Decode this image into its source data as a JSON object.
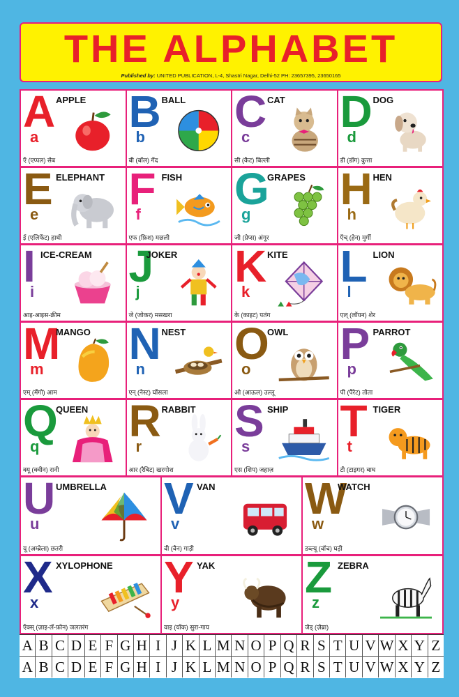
{
  "header": {
    "title": "THE ALPHABET",
    "published_by": "Published by:",
    "publisher_details": "UNITED PUBLICATION,  L-4, Shastri Nagar,  Delhi-52 PH: 23657395, 23650165"
  },
  "colors": {
    "background": "#4fb6e3",
    "header": "#fff200",
    "title": "#e8202a",
    "grid": "#e8207a"
  },
  "letters": [
    {
      "upper": "A",
      "lower": "a",
      "word": "APPLE",
      "hindi": "एँ (एप्पल) सेब",
      "color": "#e8202a",
      "icon": "apple-icon"
    },
    {
      "upper": "B",
      "lower": "b",
      "word": "BALL",
      "hindi": "बी (बॉल) गेंद",
      "color": "#1f62b4",
      "icon": "ball-icon"
    },
    {
      "upper": "C",
      "lower": "c",
      "word": "CAT",
      "hindi": "सी (कैट) बिल्ली",
      "color": "#7a3d9a",
      "icon": "cat-icon"
    },
    {
      "upper": "D",
      "lower": "d",
      "word": "DOG",
      "hindi": "डी (डॉग) कुत्ता",
      "color": "#1a9a3c",
      "icon": "dog-icon"
    },
    {
      "upper": "E",
      "lower": "e",
      "word": "ELEPHANT",
      "hindi": "ई (एलिफेंट) हाथी",
      "color": "#8a5a12",
      "icon": "elephant-icon"
    },
    {
      "upper": "F",
      "lower": "f",
      "word": "FISH",
      "hindi": "एफ (फ़िश) मछली",
      "color": "#e8207a",
      "icon": "fish-icon"
    },
    {
      "upper": "G",
      "lower": "g",
      "word": "GRAPES",
      "hindi": "जी (ग्रेप्स) अंगूर",
      "color": "#1aa39a",
      "icon": "grapes-icon"
    },
    {
      "upper": "H",
      "lower": "h",
      "word": "HEN",
      "hindi": "एँच् (हेन) मुर्गी",
      "color": "#9a6a14",
      "icon": "hen-icon"
    },
    {
      "upper": "I",
      "lower": "i",
      "word": "ICE-CREAM",
      "hindi": "आइ-आइस-क्रीम",
      "color": "#7a3d9a",
      "icon": "ice-cream-icon"
    },
    {
      "upper": "J",
      "lower": "j",
      "word": "JOKER",
      "hindi": "जे (जोकर) मसखरा",
      "color": "#1a9a3c",
      "icon": "joker-icon"
    },
    {
      "upper": "K",
      "lower": "k",
      "word": "KITE",
      "hindi": "के (काइट) पतंग",
      "color": "#e8202a",
      "icon": "kite-icon"
    },
    {
      "upper": "L",
      "lower": "l",
      "word": "LION",
      "hindi": "एल् (लॉयन) शेर",
      "color": "#1f62b4",
      "icon": "lion-icon"
    },
    {
      "upper": "M",
      "lower": "m",
      "word": "MANGO",
      "hindi": "एम् (मेंगो) आम",
      "color": "#e8202a",
      "icon": "mango-icon"
    },
    {
      "upper": "N",
      "lower": "n",
      "word": "NEST",
      "hindi": "एन् (नेस्ट) घोंसला",
      "color": "#1f62b4",
      "icon": "nest-icon"
    },
    {
      "upper": "O",
      "lower": "o",
      "word": "OWL",
      "hindi": "ओ (आऊल) उल्लू",
      "color": "#8a5a12",
      "icon": "owl-icon"
    },
    {
      "upper": "P",
      "lower": "p",
      "word": "PARROT",
      "hindi": "पी (पैरेट) तोता",
      "color": "#7a3d9a",
      "icon": "parrot-icon"
    },
    {
      "upper": "Q",
      "lower": "q",
      "word": "QUEEN",
      "hindi": "क्यू (क्वीन) रानी",
      "color": "#1a9a3c",
      "icon": "queen-icon"
    },
    {
      "upper": "R",
      "lower": "r",
      "word": "RABBIT",
      "hindi": "आर (रैबिट) खरगोश",
      "color": "#8a5a12",
      "icon": "rabbit-icon"
    },
    {
      "upper": "S",
      "lower": "s",
      "word": "SHIP",
      "hindi": "एस (शिप) जहाज़",
      "color": "#7a3d9a",
      "icon": "ship-icon"
    },
    {
      "upper": "T",
      "lower": "t",
      "word": "TIGER",
      "hindi": "टी (टाइगर) बाघ",
      "color": "#e8202a",
      "icon": "tiger-icon"
    },
    {
      "upper": "U",
      "lower": "u",
      "word": "UMBRELLA",
      "hindi": "यू (अम्ब्रेला) छतरी",
      "color": "#7a3d9a",
      "icon": "umbrella-icon"
    },
    {
      "upper": "V",
      "lower": "v",
      "word": "VAN",
      "hindi": "वी (वैन) गाड़ी",
      "color": "#1f62b4",
      "icon": "van-icon"
    },
    {
      "upper": "W",
      "lower": "w",
      "word": "WATCH",
      "hindi": "डब्ल्यू (वॉच) घड़ी",
      "color": "#8a5a12",
      "icon": "watch-icon"
    },
    {
      "upper": "X",
      "lower": "x",
      "word": "XYLOPHONE",
      "hindi": "एँक्स् (ज़ाइ-लॅ-फ़ोन) जलतरंग",
      "color": "#1f2a8a",
      "icon": "xylophone-icon"
    },
    {
      "upper": "Y",
      "lower": "y",
      "word": "YAK",
      "hindi": "वाइ (यॉक) सुरा-गाय",
      "color": "#e8202a",
      "icon": "yak-icon"
    },
    {
      "upper": "Z",
      "lower": "z",
      "word": "ZEBRA",
      "hindi": "जेड् (ज़ेब्रा)",
      "color": "#1a9a3c",
      "icon": "zebra-icon"
    }
  ],
  "strip": {
    "row1": [
      "A",
      "B",
      "C",
      "D",
      "E",
      "F",
      "G",
      "H",
      "I",
      "J",
      "K",
      "L",
      "M",
      "N",
      "O",
      "P",
      "Q",
      "R",
      "S",
      "T",
      "U",
      "V",
      "W",
      "X",
      "Y",
      "Z"
    ],
    "row2": [
      "A",
      "B",
      "C",
      "D",
      "E",
      "F",
      "G",
      "H",
      "I",
      "J",
      "K",
      "L",
      "M",
      "N",
      "O",
      "P",
      "Q",
      "R",
      "S",
      "T",
      "U",
      "V",
      "W",
      "X",
      "Y",
      "Z"
    ]
  }
}
